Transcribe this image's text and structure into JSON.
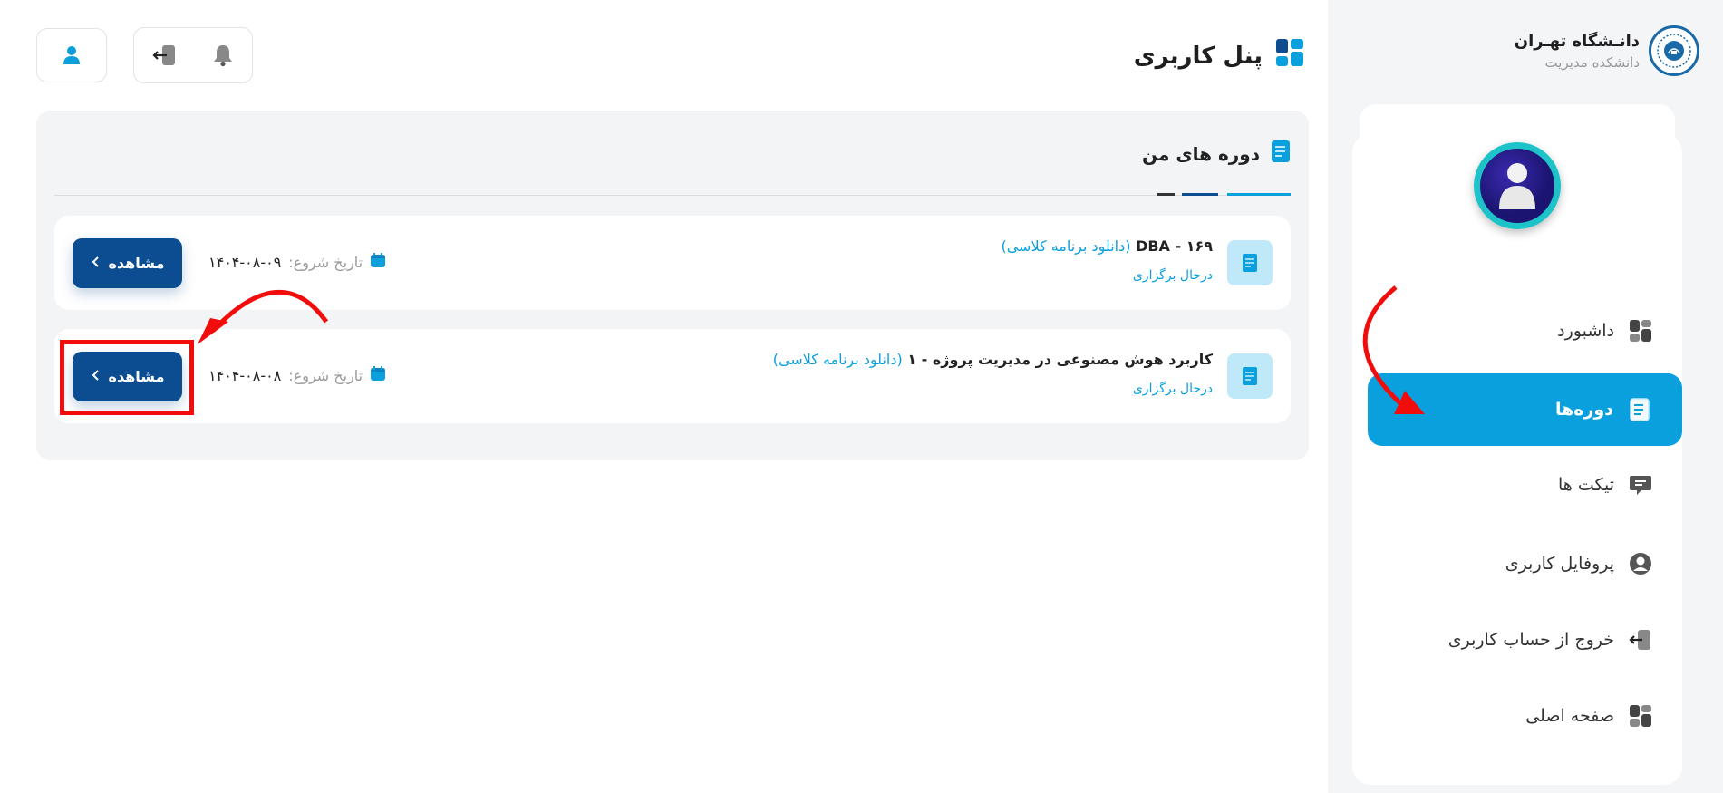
{
  "brand": {
    "title": "دانـشگاه تهـران",
    "subtitle": "دانشکده مدیریت"
  },
  "sidebar": {
    "items": [
      {
        "label": "داشبورد",
        "icon": "dashboard-icon",
        "active": false
      },
      {
        "label": "دوره‌ها",
        "icon": "book-icon",
        "active": true
      },
      {
        "label": "تیکت ها",
        "icon": "chat-icon",
        "active": false
      },
      {
        "label": "پروفایل کاربری",
        "icon": "user-circle-icon",
        "active": false
      },
      {
        "label": "خروج از حساب کاربری",
        "icon": "logout-icon",
        "active": false
      },
      {
        "label": "صفحه اصلی",
        "icon": "dashboard-icon",
        "active": false
      }
    ]
  },
  "header": {
    "title": "پنل کاربری"
  },
  "courses_section": {
    "title": "دوره های من",
    "items": [
      {
        "title": "۱۶۹ - DBA",
        "download_text": "(دانلود برنامه کلاسی)",
        "status": "درحال برگزاری",
        "date_label": "تاریخ شروع:",
        "date": "۱۴۰۴-۰۸-۰۹",
        "button_label": "مشاهده"
      },
      {
        "title": "کاربرد هوش مصنوعی در مدیریت پروژه - ۱",
        "download_text": "(دانلود برنامه کلاسی)",
        "status": "درحال برگزاری",
        "date_label": "تاریخ شروع:",
        "date": "۱۴۰۴-۰۸-۰۸",
        "button_label": "مشاهده"
      }
    ]
  },
  "colors": {
    "accent": "#0aa0de",
    "button": "#0c4d91",
    "annotation": "#f20d0d"
  }
}
